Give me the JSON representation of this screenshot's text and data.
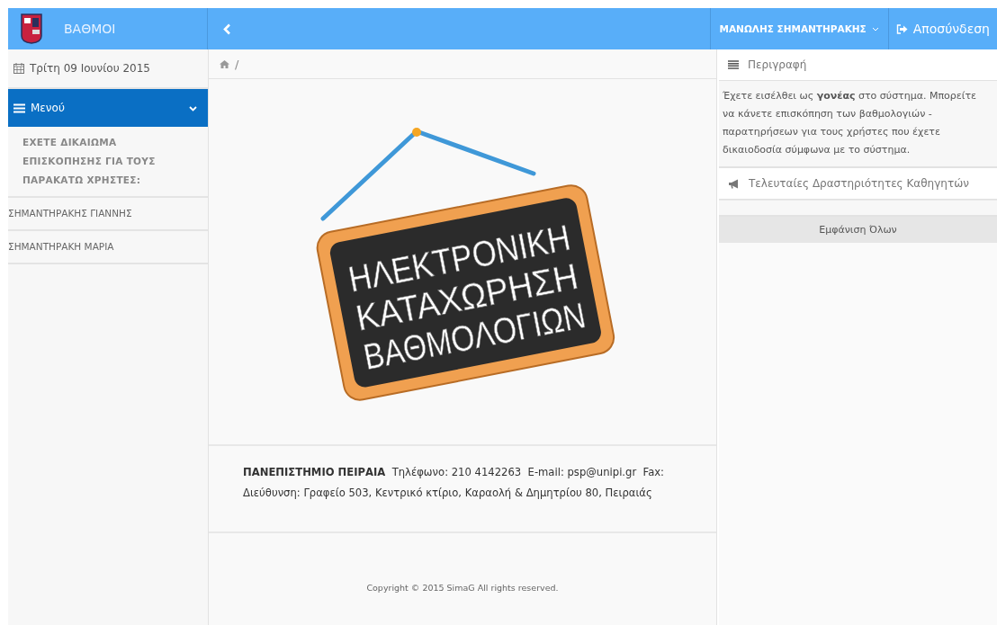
{
  "header": {
    "brand": "ΒΑΘΜΟΙ",
    "user_menu": "ΜΑΝΩΛΗΣ ΣΗΜΑΝΤΗΡΑΚΗΣ",
    "logout": "Αποσύνδεση"
  },
  "sidebar": {
    "date": "Τρίτη 09 Ιουνίου 2015",
    "menu": {
      "label": "Μενού",
      "expanded": true
    },
    "notice": "ΕΧΕΤΕ ΔΙΚΑΙΩΜΑ ΕΠΙΣΚΟΠΗΣΗΣ ΓΙΑ ΤΟΥΣ ΠΑΡΑΚΑΤΩ ΧΡΗΣΤΕΣ:",
    "users": [
      "ΣΗΜΑΝΤΗΡΑΚΗΣ ΓΙΑΝΝΗΣ",
      "ΣΗΜΑΝΤΗΡΑΚΗ ΜΑΡΙΑ"
    ]
  },
  "breadcrumb": "/",
  "sign": {
    "lines": [
      "ΗΛΕΚΤΡΟΝΙΚΗ",
      "ΚΑΤΑΧΩΡΗΣΗ",
      "ΒΑΘΜΟΛΟΓΙΩΝ"
    ]
  },
  "footer": {
    "contact": "**ΠΑΝΕΠΙΣΤΗΜΙΟ ΠΕΙΡΑΙΑ**  Τηλέφωνο: 210 4142263  E-mail: psp@unipi.gr  Fax:",
    "address": "Διεύθυνση: Γραφείο 503, Κεντρικό κτίριο, Καραολή & Δημητρίου 80, Πειραιάς",
    "copyright": "Copyright © 2015 SimaG All rights reserved."
  },
  "right": {
    "description_title": "Περιγραφή",
    "description": "Έχετε εισέλθει ως **γονέας** στο σύστημα. Μπορείτε να κάνετε επισκόπηση των βαθμολογιών - παρατηρήσεων για τους χρήστες που έχετε δικαιοδοσία σύμφωνα με το σύστημα.",
    "activity_title": "Τελευταίες Δραστηριότητες Καθηγητών",
    "show_all": "Εμφάνιση Όλων"
  }
}
